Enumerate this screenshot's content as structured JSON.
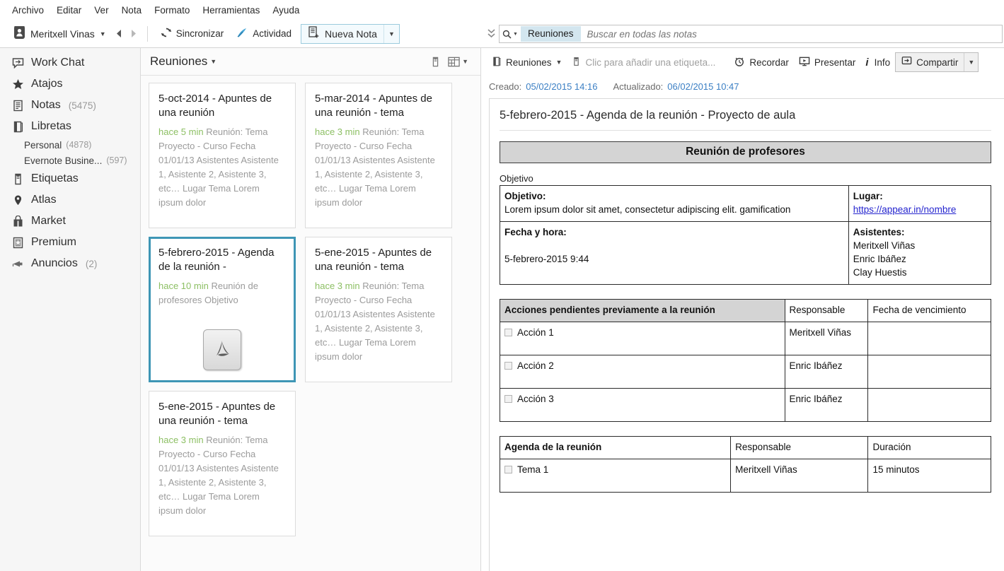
{
  "menubar": {
    "items": [
      "Archivo",
      "Editar",
      "Ver",
      "Nota",
      "Formato",
      "Herramientas",
      "Ayuda"
    ]
  },
  "toolbar": {
    "account_name": "Meritxell Vinas",
    "sync_label": "Sincronizar",
    "activity_label": "Actividad",
    "new_note_label": "Nueva Nota"
  },
  "search": {
    "scope": "Reuniones",
    "placeholder": "Buscar en todas las notas",
    "value": ""
  },
  "sidebar": {
    "items": [
      {
        "label": "Work Chat",
        "icon": "work-chat-icon",
        "count": ""
      },
      {
        "label": "Atajos",
        "icon": "star-icon",
        "count": ""
      },
      {
        "label": "Notas",
        "icon": "note-icon",
        "count": "(5475)"
      },
      {
        "label": "Libretas",
        "icon": "notebooks-icon",
        "count": ""
      }
    ],
    "notebooks": [
      {
        "label": "Personal",
        "count": "(4878)"
      },
      {
        "label": "Evernote Busine...",
        "count": "(597)"
      }
    ],
    "items2": [
      {
        "label": "Etiquetas",
        "icon": "tag-icon",
        "count": ""
      },
      {
        "label": "Atlas",
        "icon": "map-pin-icon",
        "count": ""
      },
      {
        "label": "Market",
        "icon": "shopping-bag-icon",
        "count": ""
      },
      {
        "label": "Premium",
        "icon": "premium-icon",
        "count": ""
      },
      {
        "label": "Anuncios",
        "icon": "megaphone-icon",
        "count": "(2)"
      }
    ]
  },
  "notelist": {
    "title": "Reuniones",
    "cards": [
      {
        "title": "5-oct-2014 - Apuntes de una reunión",
        "ago": "hace 5 min",
        "snippet": "Reunión: Tema Proyecto - Curso Fecha 01/01/13 Asistentes Asistente 1, Asistente 2, Asistente 3, etc… Lugar Tema Lorem ipsum dolor",
        "selected": false,
        "attachment": ""
      },
      {
        "title": "5-mar-2014 - Apuntes de una reunión - tema",
        "ago": "hace 3 min",
        "snippet": "Reunión: Tema Proyecto - Curso Fecha 01/01/13 Asistentes Asistente 1, Asistente 2, Asistente 3, etc… Lugar Tema Lorem ipsum dolor",
        "selected": false,
        "attachment": ""
      },
      {
        "title": "5-febrero-2015 - Agenda de la reunión -",
        "ago": "hace 10 min",
        "snippet": "Reunión de profesores Objetivo",
        "selected": true,
        "attachment": "pdf-icon"
      },
      {
        "title": "5-ene-2015 - Apuntes de una reunión - tema",
        "ago": "hace 3 min",
        "snippet": "Reunión: Tema Proyecto - Curso Fecha 01/01/13 Asistentes Asistente 1, Asistente 2, Asistente 3, etc… Lugar Tema Lorem ipsum dolor",
        "selected": false,
        "attachment": ""
      },
      {
        "title": "5-ene-2015 - Apuntes de una reunión - tema",
        "ago": "hace 3 min",
        "snippet": "Reunión: Tema Proyecto - Curso Fecha 01/01/13 Asistentes Asistente 1, Asistente 2, Asistente 3, etc… Lugar Tema Lorem ipsum dolor",
        "selected": false,
        "attachment": ""
      }
    ]
  },
  "notepanel": {
    "notebook": "Reuniones",
    "tag_placeholder": "Clic para añadir una etiqueta...",
    "remind_label": "Recordar",
    "present_label": "Presentar",
    "info_label": "Info",
    "share_label": "Compartir",
    "created_label": "Creado:",
    "created_value": "05/02/2015 14:16",
    "updated_label": "Actualizado:",
    "updated_value": "06/02/2015 10:47",
    "doc_title": "5-febrero-2015 - Agenda de la reunión - Proyecto de aula",
    "banner": "Reunión de profesores",
    "objective_section_label": "Objetivo",
    "table_info": {
      "objetivo_label": "Objetivo:",
      "objetivo_text": "Lorem ipsum dolor sit amet, consectetur adipiscing elit. gamification",
      "lugar_label": "Lugar:",
      "lugar_link": "https://appear.in/nombre",
      "fecha_label": "Fecha y hora:",
      "fecha_value": "5-febrero-2015 9:44",
      "asistentes_label": "Asistentes:",
      "asistentes": [
        "Meritxell Viñas",
        "Enric Ibáñez",
        "Clay Huestis"
      ]
    },
    "actions_table": {
      "headers": [
        "Acciones pendientes previamente a la reunión",
        "Responsable",
        "Fecha de vencimiento"
      ],
      "rows": [
        {
          "action": "Acción 1",
          "responsable": "Meritxell Viñas",
          "fecha": ""
        },
        {
          "action": "Acción 2",
          "responsable": "Enric Ibáñez",
          "fecha": ""
        },
        {
          "action": "Acción 3",
          "responsable": "Enric Ibáñez",
          "fecha": ""
        }
      ]
    },
    "agenda_table": {
      "headers": [
        "Agenda de la reunión",
        "Responsable",
        "Duración"
      ],
      "rows": [
        {
          "action": "Tema 1",
          "responsable": "Meritxell Viñas",
          "duracion": "15 minutos"
        }
      ]
    }
  },
  "colors": {
    "accent": "#3e96b5",
    "ago_green": "#8cbf63",
    "link_blue": "#2626cf",
    "meta_blue": "#3b7fc4"
  }
}
